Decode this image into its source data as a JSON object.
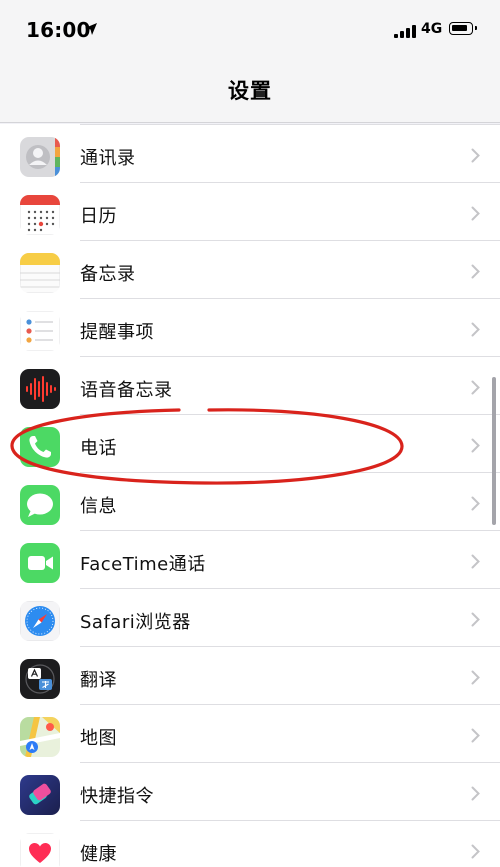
{
  "status_bar": {
    "time": "16:00",
    "network": "4G"
  },
  "nav": {
    "title": "设置"
  },
  "items": [
    {
      "label": "通讯录",
      "icon": "contacts-icon"
    },
    {
      "label": "日历",
      "icon": "calendar-icon"
    },
    {
      "label": "备忘录",
      "icon": "notes-icon"
    },
    {
      "label": "提醒事项",
      "icon": "reminders-icon"
    },
    {
      "label": "语音备忘录",
      "icon": "voice-memos-icon"
    },
    {
      "label": "电话",
      "icon": "phone-icon"
    },
    {
      "label": "信息",
      "icon": "messages-icon"
    },
    {
      "label": "FaceTime通话",
      "icon": "facetime-icon"
    },
    {
      "label": "Safari浏览器",
      "icon": "safari-icon"
    },
    {
      "label": "翻译",
      "icon": "translate-icon"
    },
    {
      "label": "地图",
      "icon": "maps-icon"
    },
    {
      "label": "快捷指令",
      "icon": "shortcuts-icon"
    },
    {
      "label": "健康",
      "icon": "health-icon"
    }
  ],
  "colors": {
    "highlight_circle": "#d9231c",
    "phone_green": "#4cd964",
    "chevron": "#c4c4c7"
  }
}
